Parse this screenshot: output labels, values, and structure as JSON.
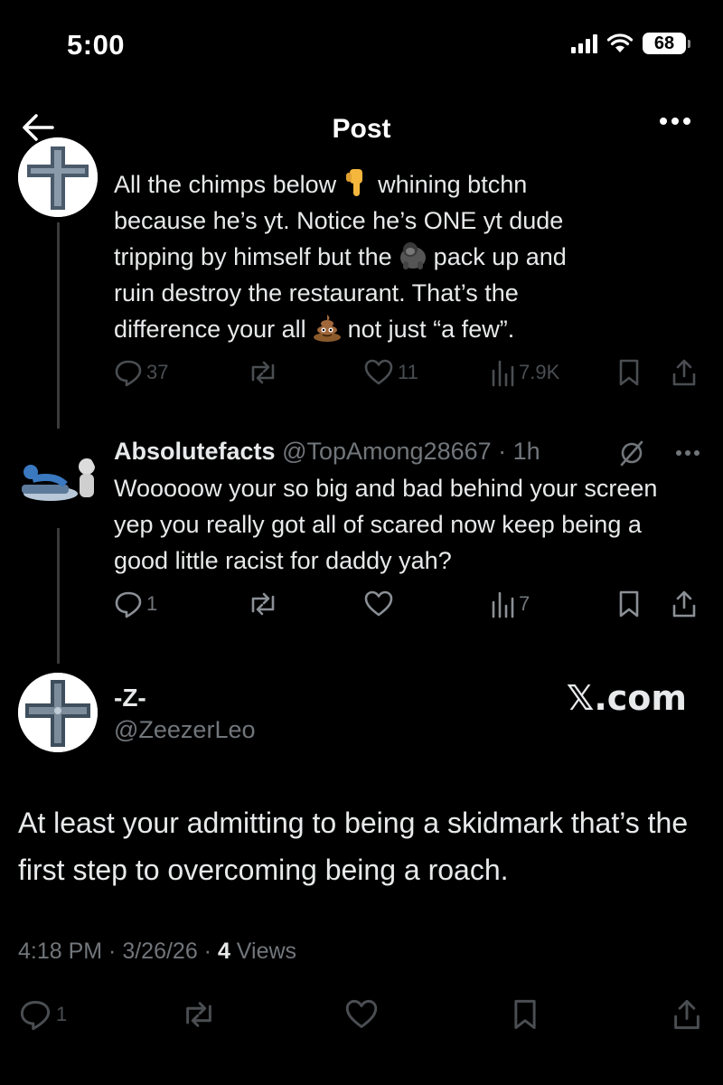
{
  "status_bar": {
    "time": "5:00",
    "battery": "68"
  },
  "nav": {
    "title": "Post"
  },
  "parent_post": {
    "line1_a": "All the chimps below",
    "line1_b": "whining btchn",
    "line2": "because he’s yt. Notice he’s ONE yt dude",
    "line3_a": "tripping by himself but the",
    "line3_b": "pack up and",
    "line4": "ruin destroy the restaurant. That’s the",
    "line5_a": "difference your all",
    "line5_b": "not just “a few”.",
    "emojis": [
      "pointing-down",
      "gorilla",
      "pile-of-poo"
    ],
    "actions": {
      "replies": "37",
      "reposts": "",
      "likes": "11",
      "views": "7.9K"
    }
  },
  "reply_post": {
    "name": "Absolutefacts",
    "handle": "@TopAmong28667",
    "time": "· 1h",
    "text": "Wooooow your so big and bad behind your screen yep you really got all of scared now keep being a good little racist for daddy yah?",
    "actions": {
      "replies": "1",
      "reposts": "",
      "likes": "",
      "views": "7"
    }
  },
  "main_post": {
    "name": "-Z-",
    "handle": "@ZeezerLeo",
    "watermark": "𝕏.com",
    "text": "At least your admitting to being a skidmark that’s the first step to overcoming being a roach.",
    "timestamp": "4:18 PM · 3/26/26 · ",
    "views_count": "4",
    "views_label": " Views",
    "actions": {
      "replies": "1"
    }
  },
  "colors": {
    "background": "#000000",
    "text": "#e7e9ea",
    "muted": "#71767b"
  }
}
